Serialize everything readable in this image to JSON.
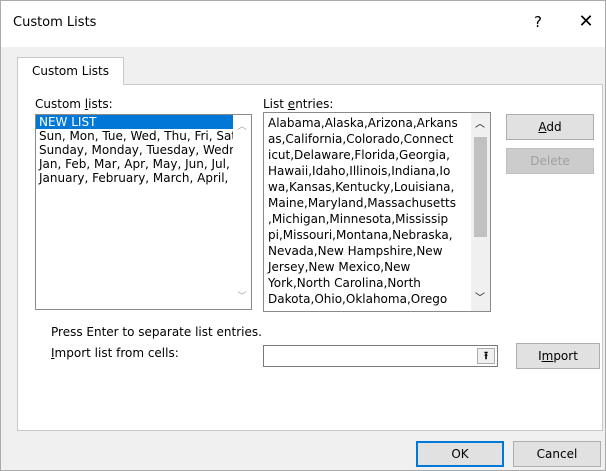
{
  "window": {
    "title": "Custom Lists",
    "help_glyph": "?",
    "close_glyph": "✕"
  },
  "tab": {
    "label": "Custom Lists"
  },
  "custom_lists": {
    "label_pre": "Custom ",
    "label_ul": "l",
    "label_post": "ists:",
    "items": [
      "NEW LIST",
      "Sun, Mon, Tue, Wed, Thu, Fri, Sat",
      "Sunday, Monday, Tuesday, Wednesday, Thursday, Friday, Saturday",
      "Jan, Feb, Mar, Apr, May, Jun, Jul, Aug, Sep, Oct, Nov, Dec",
      "January, February, March, April, May, June, July, August, September, October, November, December"
    ],
    "selected_index": 0
  },
  "list_entries": {
    "label_pre": "List ",
    "label_ul": "e",
    "label_post": "ntries:",
    "lines": [
      "Alabama,Alaska,Arizona,Arkans",
      "as,California,Colorado,Connect",
      "icut,Delaware,Florida,Georgia,",
      "Hawaii,Idaho,Illinois,Indiana,Io",
      "wa,Kansas,Kentucky,Louisiana,",
      "Maine,Maryland,Massachusetts",
      ",Michigan,Minnesota,Mississip",
      "pi,Missouri,Montana,Nebraska,",
      "Nevada,New Hampshire,New",
      "Jersey,New Mexico,New",
      "York,North Carolina,North",
      "Dakota,Ohio,Oklahoma,Orego"
    ]
  },
  "buttons": {
    "add_ul": "A",
    "add_post": "dd",
    "delete": "Delete",
    "import_pre": "I",
    "import_ul": "m",
    "import_post": "port",
    "ok": "OK",
    "cancel": "Cancel"
  },
  "help_text": "Press Enter to separate list entries.",
  "import": {
    "label_pre": "",
    "label_ul": "I",
    "label_post": "mport list from cells:",
    "value": "",
    "collapse_glyph": "⭱"
  },
  "colors": {
    "selection": "#0078d7",
    "dialog_bg": "#f0f0f0",
    "panel_bg": "#ffffff",
    "disabled_text": "#a0a0a0"
  }
}
